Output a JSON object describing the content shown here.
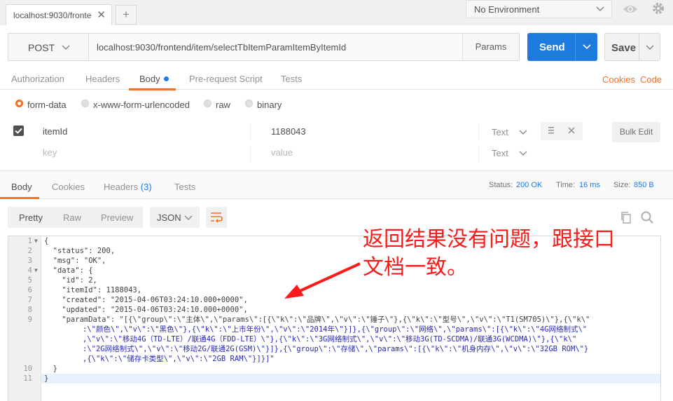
{
  "tab": {
    "title": "localhost:9030/fronte",
    "close": "✕",
    "new": "+"
  },
  "environment": {
    "label": "No Environment"
  },
  "request": {
    "method": "POST",
    "url": "localhost:9030/frontend/item/selectTbItemParamItemByItemId",
    "params_label": "Params",
    "send_label": "Send",
    "save_label": "Save"
  },
  "request_tabs": [
    "Authorization",
    "Headers",
    "Body",
    "Pre-request Script",
    "Tests"
  ],
  "request_links": {
    "cookies": "Cookies",
    "code": "Code"
  },
  "body_types": [
    "form-data",
    "x-www-form-urlencoded",
    "raw",
    "binary"
  ],
  "body_type_selected": "form-data",
  "form_rows": [
    {
      "checked": true,
      "key": "itemId",
      "value": "1188043",
      "type": "Text"
    }
  ],
  "form_placeholder": {
    "key": "key",
    "value": "value",
    "type": "Text"
  },
  "bulk_edit_label": "Bulk Edit",
  "response_tabs": {
    "body": "Body",
    "cookies": "Cookies",
    "headers": "Headers",
    "headers_count": "(3)",
    "tests": "Tests"
  },
  "response_status": {
    "status_label": "Status:",
    "status": "200 OK",
    "time_label": "Time:",
    "time": "16 ms",
    "size_label": "Size:",
    "size": "850 B"
  },
  "view_modes": [
    "Pretty",
    "Raw",
    "Preview"
  ],
  "view_mode_selected": "Pretty",
  "format": "JSON",
  "code_lines": [
    "{",
    "  \"status\": 200,",
    "  \"msg\": \"OK\",",
    "  \"data\": {",
    "    \"id\": 2,",
    "    \"itemId\": 1188043,",
    "    \"created\": \"2015-04-06T03:24:10.000+0000\",",
    "    \"updated\": \"2015-04-06T03:24:10.000+0000\",",
    "    \"paramData\": \"[{\\\"group\\\":\\\"主体\\\",\\\"params\\\":[{\\\"k\\\":\\\"品牌\\\",\\\"v\\\":\\\"锤子\\\"},{\\\"k\\\":\\\"型号\\\",\\\"v\\\":\\\"T1(SM705)\\\"},{\\\"k\\\"",
    "  }",
    "}"
  ],
  "code_continuations": [
    ":\\\"颜色\\\",\\\"v\\\":\\\"黑色\\\"},{\\\"k\\\":\\\"上市年份\\\",\\\"v\\\":\\\"2014年\\\"}]},{\\\"group\\\":\\\"网络\\\",\\\"params\\\":[{\\\"k\\\":\\\"4G网络制式\\\"",
    ",\\\"v\\\":\\\"移动4G（TD-LTE）/联通4G（FDD-LTE）\\\"},{\\\"k\\\":\\\"3G网络制式\\\",\\\"v\\\":\\\"移动3G(TD-SCDMA)/联通3G(WCDMA)\\\"},{\\\"k\\\"",
    ":\\\"2G网络制式\\\",\\\"v\\\":\\\"移动2G/联通2G(GSM)\\\"}]},{\\\"group\\\":\\\"存储\\\",\\\"params\\\":[{\\\"k\\\":\\\"机身内存\\\",\\\"v\\\":\\\"32GB ROM\\\"}",
    ",{\\\"k\\\":\\\"储存卡类型\\\",\\\"v\\\":\\\"2GB RAM\\\"}]}]\""
  ],
  "line_numbers": [
    "1",
    "2",
    "3",
    "4",
    "5",
    "6",
    "7",
    "8",
    "9",
    "10",
    "11"
  ],
  "annotation": {
    "line1": "返回结果没有问题，跟接口",
    "line2": "文档一致。"
  },
  "colors": {
    "accent": "#f47023",
    "send": "#1f7ae0",
    "annotation": "#ff1a1a"
  }
}
